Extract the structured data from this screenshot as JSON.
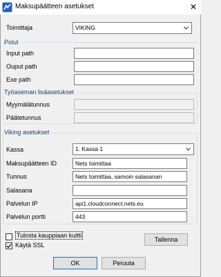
{
  "window": {
    "title": "Maksupäätteen asetukset",
    "close_glyph": "✕"
  },
  "provider": {
    "label": "Toimittaja",
    "value": "VIKING"
  },
  "paths": {
    "title": "Polut",
    "input_path_label": "Input path",
    "output_path_label": "Ouput path",
    "exe_path_label": "Exe path",
    "input_path": "",
    "output_path": "",
    "exe_path": ""
  },
  "workstation": {
    "title": "Työaseman lisäasetukset",
    "store_id_label": "Myymälätunnus",
    "terminal_id_label": "Päätetunnus",
    "store_id": "",
    "terminal_id": ""
  },
  "viking": {
    "title": "Viking asetukset",
    "register_label": "Kassa",
    "register_value": "1. Kassa 1",
    "terminal_id_label": "Maksupäätteen ID",
    "terminal_id": "Nets toimittaa",
    "username_label": "Tunnus",
    "username": "Nets toimittaa, samoin salasanan",
    "password_label": "Salasana",
    "password": "",
    "service_ip_label": "Palvelun IP",
    "service_ip": "api1.cloudconnect.nets.eu",
    "service_port_label": "Palvelun portti",
    "service_port": "443"
  },
  "options": {
    "print_receipt_label": "Tulosta kauppiaan kuitti",
    "print_receipt_checked": false,
    "use_ssl_label": "Käytä SSL",
    "use_ssl_checked": true
  },
  "buttons": {
    "save": "Tallenna",
    "ok": "OK",
    "cancel": "Peruuta"
  },
  "colors": {
    "group_title": "#1b3e7a",
    "default_button_border": "#0078d7"
  },
  "icons": {
    "app": "app-icon",
    "close": "close-icon",
    "dropdown": "chevron-down-icon",
    "check": "checkmark-icon"
  }
}
